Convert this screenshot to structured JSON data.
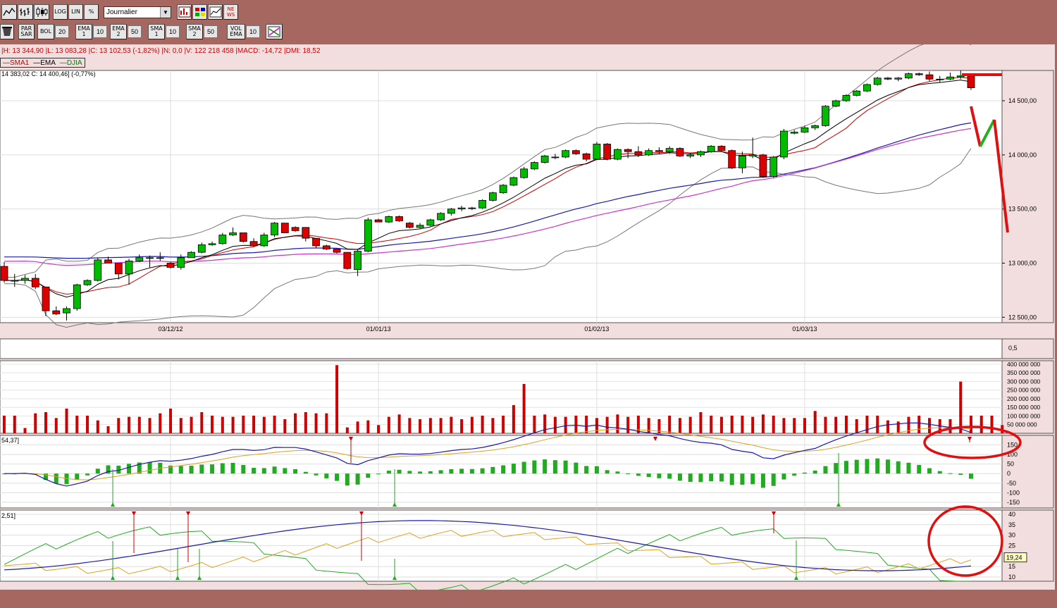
{
  "toolbar1": {
    "buttons": [
      {
        "name": "line-chart-icon"
      },
      {
        "name": "bar-chart-icon"
      },
      {
        "name": "candlestick-icon"
      },
      {
        "label": "LOG"
      },
      {
        "label": "LIN"
      },
      {
        "label": "%"
      }
    ],
    "period": "Journalier",
    "tools": [
      {
        "name": "chart-tool-icon"
      },
      {
        "name": "colors-icon"
      },
      {
        "name": "compare-icon"
      },
      {
        "label": "NE WS"
      }
    ]
  },
  "toolbar2": {
    "items": [
      {
        "label": "PAR SAR",
        "value": ""
      },
      {
        "label": "BOL",
        "value": "20"
      },
      {
        "label": "EMA 1",
        "value": "10"
      },
      {
        "label": "EMA 2",
        "value": "50"
      },
      {
        "label": "SMA 1",
        "value": "10"
      },
      {
        "label": "SMA 2",
        "value": "50"
      },
      {
        "label": "VOL EMA",
        "value": "10"
      }
    ]
  },
  "info_line": "|H: 13 344,90 |L: 13 083,28 |C: 13 102,53 (-1,82%) |N: 0,0 |V: 122 218 458 |MACD: -14,72 |DMI: 18,52",
  "legend": [
    {
      "label": "SMA1",
      "color": "#cc0000"
    },
    {
      "label": "EMA",
      "color": "#000000"
    },
    {
      "label": "DJIA",
      "color": "#008000"
    }
  ],
  "close_text": "14 383,02  C: 14 400,46] (-0,77%)",
  "price_axis": [
    "14 500,00",
    "14 000,00",
    "13 500,00",
    "13 000,00",
    "12 500,00"
  ],
  "date_axis": [
    "03/12/12",
    "01/01/13",
    "01/02/13",
    "01/03/13"
  ],
  "small_panel_axis": [
    "0,5"
  ],
  "volume_axis": [
    "400 000 000",
    "350 000 000",
    "300 000 000",
    "250 000 000",
    "200 000 000",
    "150 000 000",
    "100 000 000",
    "50 000 000"
  ],
  "macd_title": "54,37]",
  "macd_axis": [
    "150",
    "100",
    "50",
    "0",
    "-50",
    "-100",
    "-150"
  ],
  "dmi_title": "2,51]",
  "dmi_axis": [
    "40",
    "35",
    "30",
    "25",
    "20",
    "15",
    "10"
  ],
  "dmi_marker": "19,24",
  "colors": {
    "up": "#00bb00",
    "down": "#dd0000",
    "background": "#f2dede",
    "frame": "#a5675f"
  },
  "chart_data": {
    "type": "candlestick",
    "title": "",
    "y_range": [
      12450,
      14780
    ],
    "candles": [
      [
        12970,
        13010,
        12820,
        12840
      ],
      [
        12840,
        12900,
        12780,
        12840
      ],
      [
        12840,
        12890,
        12810,
        12860
      ],
      [
        12860,
        12900,
        12760,
        12780
      ],
      [
        12780,
        12780,
        12510,
        12560
      ],
      [
        12560,
        12600,
        12520,
        12530
      ],
      [
        12540,
        12600,
        12470,
        12580
      ],
      [
        12580,
        12810,
        12560,
        12800
      ],
      [
        12800,
        12850,
        12790,
        12840
      ],
      [
        12840,
        13050,
        12830,
        13030
      ],
      [
        13030,
        13060,
        13000,
        13000
      ],
      [
        13000,
        13000,
        12850,
        12900
      ],
      [
        12900,
        13040,
        12800,
        13020
      ],
      [
        13020,
        13080,
        13010,
        13050
      ],
      [
        13050,
        13070,
        12960,
        13050
      ],
      [
        13050,
        13100,
        13020,
        13050
      ],
      [
        13000,
        13010,
        12950,
        12960
      ],
      [
        12960,
        13080,
        12940,
        13050
      ],
      [
        13050,
        13110,
        13050,
        13100
      ],
      [
        13100,
        13190,
        13090,
        13170
      ],
      [
        13170,
        13200,
        13160,
        13180
      ],
      [
        13180,
        13280,
        13170,
        13260
      ],
      [
        13260,
        13330,
        13250,
        13280
      ],
      [
        13280,
        13280,
        13190,
        13200
      ],
      [
        13200,
        13230,
        13150,
        13160
      ],
      [
        13160,
        13280,
        13150,
        13260
      ],
      [
        13260,
        13380,
        13240,
        13370
      ],
      [
        13370,
        13370,
        13280,
        13280
      ],
      [
        13330,
        13340,
        13290,
        13300
      ],
      [
        13330,
        13330,
        13200,
        13230
      ],
      [
        13230,
        13230,
        13140,
        13160
      ],
      [
        13160,
        13170,
        13120,
        13130
      ],
      [
        13130,
        13130,
        13090,
        13100
      ],
      [
        13100,
        13100,
        12940,
        12950
      ],
      [
        12940,
        13130,
        12880,
        13110
      ],
      [
        13110,
        13420,
        13100,
        13400
      ],
      [
        13400,
        13410,
        13380,
        13380
      ],
      [
        13380,
        13440,
        13370,
        13430
      ],
      [
        13430,
        13440,
        13380,
        13390
      ],
      [
        13370,
        13380,
        13320,
        13330
      ],
      [
        13330,
        13370,
        13320,
        13350
      ],
      [
        13350,
        13410,
        13340,
        13400
      ],
      [
        13400,
        13470,
        13390,
        13460
      ],
      [
        13460,
        13510,
        13440,
        13500
      ],
      [
        13500,
        13530,
        13480,
        13510
      ],
      [
        13510,
        13520,
        13490,
        13510
      ],
      [
        13510,
        13590,
        13500,
        13580
      ],
      [
        13580,
        13660,
        13570,
        13650
      ],
      [
        13650,
        13730,
        13640,
        13720
      ],
      [
        13720,
        13800,
        13710,
        13790
      ],
      [
        13790,
        13890,
        13780,
        13870
      ],
      [
        13870,
        13940,
        13860,
        13930
      ],
      [
        13930,
        14000,
        13920,
        13990
      ],
      [
        13980,
        14010,
        13960,
        13980
      ],
      [
        13980,
        14050,
        13970,
        14040
      ],
      [
        14040,
        14050,
        14000,
        14010
      ],
      [
        14010,
        14020,
        13940,
        13960
      ],
      [
        13960,
        14120,
        13950,
        14100
      ],
      [
        14100,
        14110,
        13950,
        13960
      ],
      [
        13960,
        14060,
        13950,
        14050
      ],
      [
        14050,
        14060,
        13970,
        14030
      ],
      [
        14030,
        14080,
        13980,
        14000
      ],
      [
        14000,
        14060,
        13990,
        14040
      ],
      [
        14040,
        14070,
        14010,
        14030
      ],
      [
        14030,
        14080,
        14010,
        14060
      ],
      [
        14060,
        14070,
        13980,
        13990
      ],
      [
        13990,
        14020,
        13970,
        14000
      ],
      [
        14000,
        14040,
        13980,
        14030
      ],
      [
        14030,
        14090,
        14020,
        14080
      ],
      [
        14080,
        14090,
        14030,
        14040
      ],
      [
        14040,
        14050,
        13870,
        13880
      ],
      [
        13880,
        14030,
        13830,
        13990
      ],
      [
        13990,
        14160,
        13970,
        14000
      ],
      [
        14000,
        14010,
        13790,
        13800
      ],
      [
        13800,
        13990,
        13790,
        13980
      ],
      [
        13980,
        14240,
        13960,
        14220
      ],
      [
        14200,
        14230,
        14190,
        14210
      ],
      [
        14210,
        14270,
        14200,
        14250
      ],
      [
        14250,
        14280,
        14230,
        14270
      ],
      [
        14270,
        14460,
        14260,
        14450
      ],
      [
        14450,
        14510,
        14440,
        14500
      ],
      [
        14500,
        14560,
        14490,
        14550
      ],
      [
        14550,
        14600,
        14540,
        14590
      ],
      [
        14590,
        14660,
        14580,
        14650
      ],
      [
        14650,
        14720,
        14640,
        14710
      ],
      [
        14710,
        14720,
        14690,
        14700
      ],
      [
        14700,
        14720,
        14680,
        14710
      ],
      [
        14710,
        14760,
        14700,
        14750
      ],
      [
        14750,
        14760,
        14730,
        14740
      ],
      [
        14740,
        14770,
        14680,
        14700
      ],
      [
        14700,
        14730,
        14670,
        14700
      ],
      [
        14700,
        14760,
        14690,
        14720
      ],
      [
        14720,
        14780,
        14700,
        14730
      ],
      [
        14730,
        14740,
        14600,
        14620
      ]
    ],
    "volume": [
      150,
      150,
      45,
      170,
      180,
      130,
      210,
      150,
      150,
      110,
      60,
      130,
      140,
      140,
      130,
      170,
      210,
      130,
      140,
      180,
      150,
      140,
      140,
      150,
      150,
      140,
      150,
      120,
      170,
      180,
      170,
      170,
      580,
      50,
      100,
      110,
      70,
      140,
      160,
      130,
      120,
      130,
      130,
      140,
      120,
      140,
      150,
      130,
      150,
      240,
      420,
      150,
      160,
      140,
      140,
      150,
      150,
      130,
      140,
      160,
      140,
      150,
      130,
      120,
      150,
      130,
      140,
      180,
      150,
      140,
      150,
      150,
      140,
      160,
      150,
      130,
      130,
      130,
      190,
      140,
      140,
      150,
      120,
      150,
      150,
      110,
      100,
      140,
      150,
      130,
      120,
      120,
      440,
      150,
      150,
      150,
      70
    ],
    "volume_axis_range": [
      0,
      420000000
    ],
    "macd_range": [
      -180,
      200
    ],
    "dmi_range": [
      8,
      42
    ]
  }
}
